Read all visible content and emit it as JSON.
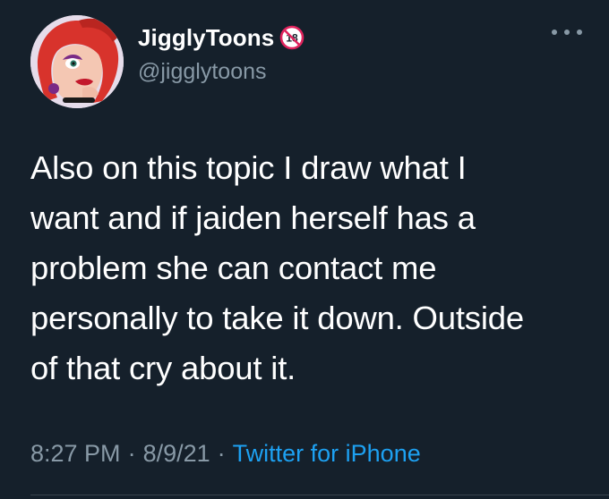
{
  "user": {
    "display_name": "JigglyToons",
    "handle": "@jigglytoons",
    "badge_icon": "18-plus-icon",
    "avatar_icon": "cartoon-avatar-icon"
  },
  "tweet": {
    "text": "Also on this topic I draw what I\nwant and if jaiden herself has a\nproblem she can contact me\npersonally to take it down. Outside\nof that cry about it.",
    "time": "8:27 PM",
    "date": "8/9/21",
    "separator": "·",
    "source": "Twitter for iPhone"
  },
  "menu": {
    "icon": "more-options-icon"
  },
  "colors": {
    "background": "#15202b",
    "secondary_text": "#8899a6",
    "link": "#1da1f2",
    "badge_red": "#e0245e"
  }
}
